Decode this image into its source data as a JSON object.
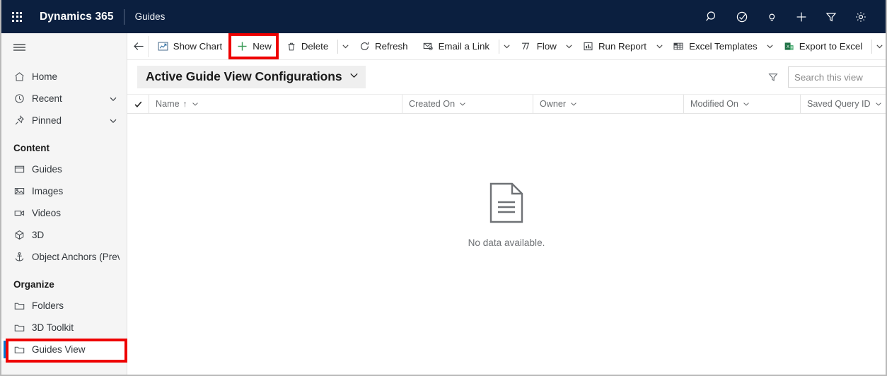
{
  "topbar": {
    "waffle_icon": "app-launcher-waffle-icon",
    "brand": "Dynamics 365",
    "app_name": "Guides",
    "actions": [
      {
        "name": "search-icon",
        "label": "Search"
      },
      {
        "name": "diagnostics-icon",
        "label": "Diagnostics"
      },
      {
        "name": "lightbulb-icon",
        "label": "Assistant"
      },
      {
        "name": "quick-create-plus-icon",
        "label": "Quick create"
      },
      {
        "name": "filter-funnel-icon",
        "label": "Filter"
      },
      {
        "name": "gear-icon",
        "label": "Settings"
      }
    ]
  },
  "sidebar": {
    "menu_icon": "hamburger-icon",
    "items": [
      {
        "label": "Home",
        "icon": "home-icon",
        "chevron": false,
        "selected": false
      },
      {
        "label": "Recent",
        "icon": "clock-icon",
        "chevron": true,
        "selected": false
      },
      {
        "label": "Pinned",
        "icon": "pin-icon",
        "chevron": true,
        "selected": false
      }
    ],
    "groups": [
      {
        "title": "Content",
        "items": [
          {
            "label": "Guides",
            "icon": "guide-window-icon",
            "selected": false
          },
          {
            "label": "Images",
            "icon": "image-icon",
            "selected": false
          },
          {
            "label": "Videos",
            "icon": "video-camera-icon",
            "selected": false
          },
          {
            "label": "3D",
            "icon": "cube-icon",
            "selected": false
          },
          {
            "label": "Object Anchors (Prev...",
            "icon": "anchor-icon",
            "selected": false
          }
        ]
      },
      {
        "title": "Organize",
        "items": [
          {
            "label": "Folders",
            "icon": "folder-icon",
            "selected": false
          },
          {
            "label": "3D Toolkit",
            "icon": "folder-icon",
            "selected": false
          },
          {
            "label": "Guides View",
            "icon": "folder-icon",
            "selected": true
          }
        ]
      }
    ]
  },
  "commandbar": {
    "back": {
      "label": "Back",
      "icon": "arrow-left-icon"
    },
    "buttons": [
      {
        "label": "Show Chart",
        "icon": "chart-icon",
        "chevron": false,
        "highlighted": false
      },
      {
        "label": "New",
        "icon": "plus-icon",
        "chevron": false,
        "highlighted": true
      },
      {
        "label": "Delete",
        "icon": "trash-icon",
        "chevron": false,
        "divider_after": true,
        "chevron_after": true
      },
      {
        "label": "Refresh",
        "icon": "refresh-icon",
        "chevron": false
      },
      {
        "label": "Email a Link",
        "icon": "email-link-icon",
        "divider_after": true,
        "chevron_after": true
      },
      {
        "label": "Flow",
        "icon": "flow-icon",
        "chevron_after": true
      },
      {
        "label": "Run Report",
        "icon": "run-report-icon",
        "chevron_after": true
      },
      {
        "label": "Excel Templates",
        "icon": "excel-templates-icon",
        "chevron_after": true
      },
      {
        "label": "Export to Excel",
        "icon": "export-excel-icon",
        "divider_after": true,
        "chevron_after": true
      }
    ]
  },
  "view": {
    "selected": "Active Guide View Configurations",
    "selector_chevron_icon": "chevron-down-icon",
    "filter_icon": "filter-funnel-icon",
    "search": {
      "placeholder": "Search this view",
      "value": ""
    }
  },
  "grid": {
    "select_all_icon": "checkmark-icon",
    "columns": [
      {
        "label": "Name",
        "sorted": "asc",
        "sort_glyph": "↑"
      },
      {
        "label": "Created On",
        "sorted": ""
      },
      {
        "label": "Owner",
        "sorted": ""
      },
      {
        "label": "Modified On",
        "sorted": ""
      },
      {
        "label": "Saved Query ID",
        "sorted": ""
      }
    ],
    "rows": [],
    "empty_message": "No data available.",
    "empty_icon": "document-page-icon"
  },
  "colors": {
    "topbar_bg": "#0b1f3f",
    "accent_blue": "#0078d4",
    "new_plus_green": "#3a9b57",
    "excel_green": "#1d7044",
    "annotation_red": "#ee0000",
    "sidebar_bg": "#f5f5f5"
  },
  "annotations": [
    {
      "name": "annotation-box-new-button",
      "target": "New"
    },
    {
      "name": "annotation-box-guides-view",
      "target": "Guides View"
    }
  ]
}
